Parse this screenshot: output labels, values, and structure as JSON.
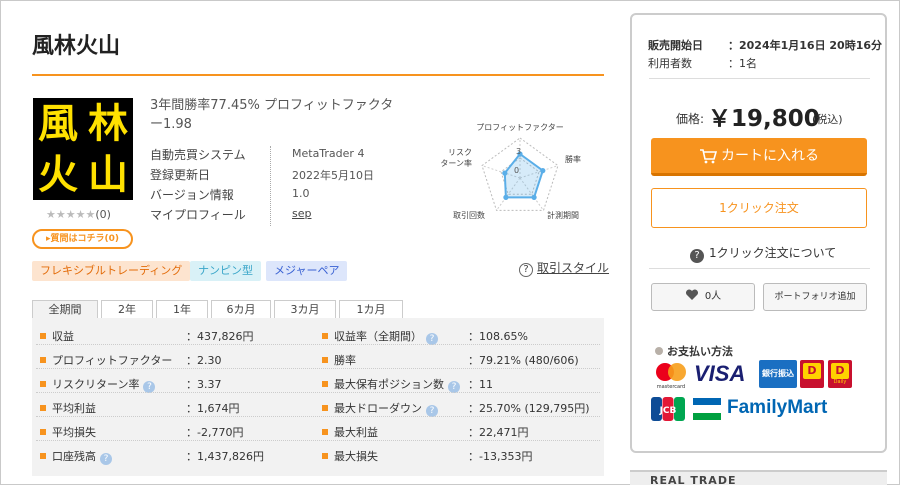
{
  "title": "風林火山",
  "logo": {
    "chars": [
      "風",
      "林",
      "火",
      "山"
    ],
    "color": "#ffe100",
    "background": "#000000"
  },
  "rating": {
    "stars": "★★★★★",
    "count": "(0)"
  },
  "qa_button": "▸質問はコチラ(0)",
  "headline": "3年間勝率77.45% プロフィットファクター1.98",
  "specs": [
    {
      "label": "自動売買システム",
      "value": "MetaTrader 4"
    },
    {
      "label": "登録更新日",
      "value": "2022年5月10日"
    },
    {
      "label": "バージョン情報",
      "value": "1.0"
    },
    {
      "label": "マイプロフィール",
      "value": "sep"
    }
  ],
  "radar": {
    "axes": [
      "プロフィットファクター",
      "勝率",
      "計測期間",
      "取引回数",
      "リスクターン率"
    ],
    "axis_label_lines": {
      "risk": [
        "リスク",
        "ターン率"
      ]
    },
    "scale_labels": [
      "3",
      "0"
    ],
    "values": [
      3,
      3,
      3,
      3,
      2
    ],
    "max": 5,
    "color": "#5aaee8"
  },
  "tags": [
    "フレキシブルトレーディング",
    "ナンピン型",
    "メジャーペア"
  ],
  "tag_colors": {
    "flex": "#e36c0a",
    "nanpin": "#3aa6c9",
    "major": "#3a62d3"
  },
  "trade_style_link": "取引スタイル",
  "tabs": [
    "全期間",
    "2年",
    "1年",
    "6カ月",
    "3カ月",
    "1カ月"
  ],
  "active_tab": "全期間",
  "stats_left": [
    {
      "label": "収益",
      "value": "：437,826円",
      "help": false
    },
    {
      "label": "プロフィットファクター",
      "value": "：2.30",
      "help": false
    },
    {
      "label": "リスクリターン率",
      "value": "：3.37",
      "help": true
    },
    {
      "label": "平均利益",
      "value": "：1,674円",
      "help": false
    },
    {
      "label": "平均損失",
      "value": "：-2,770円",
      "help": false
    },
    {
      "label": "口座残高",
      "value": "：1,437,826円",
      "help": true
    }
  ],
  "stats_right": [
    {
      "label": "収益率（全期間）",
      "value": "：108.65%",
      "help": true
    },
    {
      "label": "勝率",
      "value": "：79.21% (480/606)",
      "help": false
    },
    {
      "label": "最大保有ポジション数",
      "value": "：11",
      "help": true
    },
    {
      "label": "最大ドローダウン",
      "value": "：25.70% (129,795円)",
      "help": true
    },
    {
      "label": "最大利益",
      "value": "：22,471円",
      "help": false
    },
    {
      "label": "最大損失",
      "value": "：-13,353円",
      "help": false
    }
  ],
  "help_glyph": "?",
  "sidebar": {
    "release_label": "販売開始日",
    "release_value": "：2024年1月16日 20時16分",
    "users_label": "利用者数",
    "users_value": "：1名",
    "price_label": "価格:",
    "price": "￥19,800",
    "tax": "(税込)",
    "cart_button": "カートに入れる",
    "oneclick_button": "1クリック注文",
    "about_oneclick": "1クリック注文について",
    "like_count": "0人",
    "portfolio_button": "ポートフォリオ追加",
    "payment_title": "お支払い方法",
    "payment": {
      "mastercard": "mastercard",
      "visa": "VISA",
      "bank": "銀行振込",
      "docomo": "D",
      "daily": "Daily",
      "jcb": "JCB",
      "familymart": "FamilyMart"
    },
    "accent_color": "#f7931e"
  },
  "real_trade": "REAL TRADE"
}
